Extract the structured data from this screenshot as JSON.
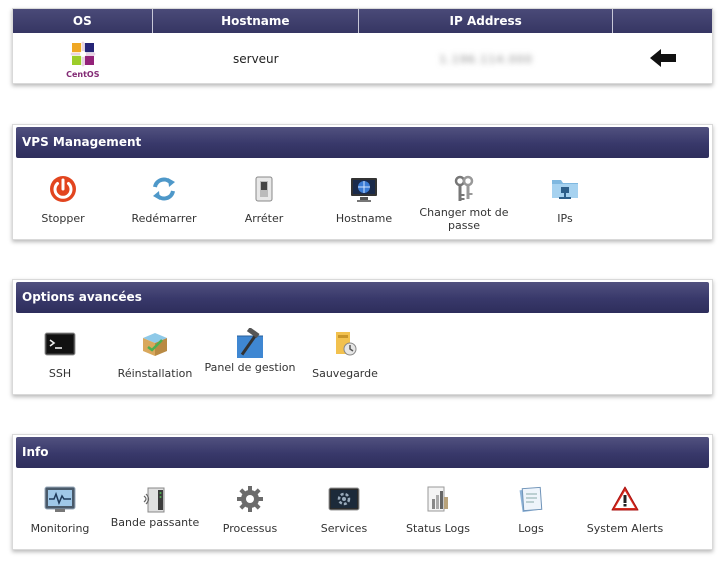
{
  "server_table": {
    "headers": [
      "OS",
      "Hostname",
      "IP Address",
      ""
    ],
    "os_logo_text": "CentOS",
    "hostname": "serveur",
    "ip_address": "1.196.114.000"
  },
  "panels": [
    {
      "title": "VPS Management",
      "items": [
        {
          "label": "Stopper",
          "icon": "power-icon"
        },
        {
          "label": "Redémarrer",
          "icon": "refresh-icon"
        },
        {
          "label": "Arréter",
          "icon": "switch-icon"
        },
        {
          "label": "Hostname",
          "icon": "monitor-globe-icon"
        },
        {
          "label": "Changer mot de passe",
          "icon": "keys-icon"
        },
        {
          "label": "IPs",
          "icon": "network-folder-icon"
        }
      ]
    },
    {
      "title": "Options avancées",
      "items": [
        {
          "label": "SSH",
          "icon": "terminal-icon"
        },
        {
          "label": "Réinstallation",
          "icon": "package-icon"
        },
        {
          "label": "Panel de gestion",
          "icon": "tools-icon"
        },
        {
          "label": "Sauvegarde",
          "icon": "backup-icon"
        }
      ]
    },
    {
      "title": "Info",
      "items": [
        {
          "label": "Monitoring",
          "icon": "monitoring-icon"
        },
        {
          "label": "Bande passante",
          "icon": "bandwidth-icon"
        },
        {
          "label": "Processus",
          "icon": "gear-icon"
        },
        {
          "label": "Services",
          "icon": "services-icon"
        },
        {
          "label": "Status Logs",
          "icon": "status-logs-icon"
        },
        {
          "label": "Logs",
          "icon": "logs-icon"
        },
        {
          "label": "System Alerts",
          "icon": "alert-icon"
        }
      ]
    }
  ],
  "colors": {
    "header_bar": "#38386a",
    "power_red": "#e2451f",
    "refresh_blue": "#4e98c9",
    "alert_red": "#d52c1e"
  }
}
